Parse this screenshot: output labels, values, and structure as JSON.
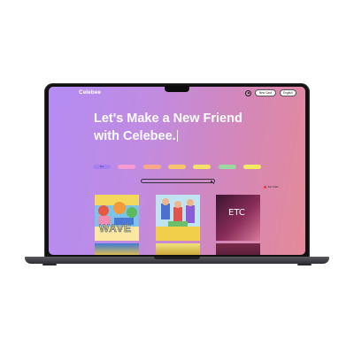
{
  "app": {
    "logo": "Celebee"
  },
  "nav": {
    "button_1": "New Card",
    "button_2": "English"
  },
  "hero": {
    "line_1": "Let's Make a New Friend",
    "line_2": "with Celebee."
  },
  "chips": [
    {
      "label": "ALL",
      "color": "#a77ff2"
    },
    {
      "label": "",
      "color": "#f59bd1"
    },
    {
      "label": "",
      "color": "#f7a98a"
    },
    {
      "label": "",
      "color": "#f6c46c"
    },
    {
      "label": "",
      "color": "#f4e06b"
    },
    {
      "label": "",
      "color": "#9ed7a0"
    },
    {
      "label": "",
      "color": "#f2ea63"
    }
  ],
  "search": {
    "text": ""
  },
  "sort": {
    "label": "Sort Order"
  },
  "cards": [
    {
      "title": "WAVE"
    },
    {
      "title": ""
    },
    {
      "title": "ETC"
    }
  ],
  "colors": {
    "gradient_start": "#b38cf4",
    "gradient_end": "#e48a99",
    "text": "#ffffff"
  }
}
